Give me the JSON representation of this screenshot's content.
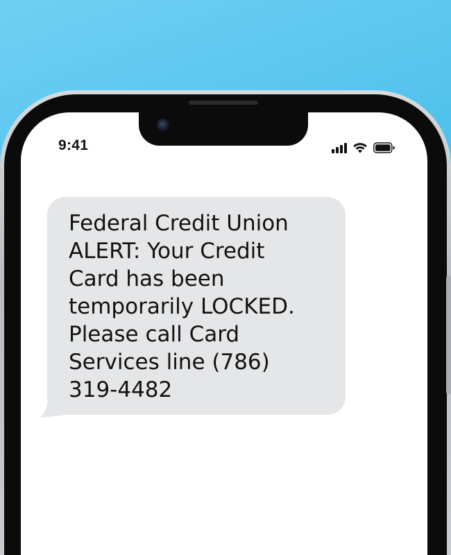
{
  "status_bar": {
    "time": "9:41",
    "icons": [
      "cellular-signal-icon",
      "wifi-icon",
      "battery-icon"
    ]
  },
  "conversation": {
    "messages": [
      {
        "direction": "incoming",
        "text": "Federal Credit Union\nALERT: Your Credit\nCard has been\ntemporarily LOCKED.\nPlease call Card\nServices line (786)\n319-4482"
      }
    ]
  },
  "colors": {
    "background": "#4cc0ec",
    "bubble": "#e5e6e8",
    "screen": "#ffffff",
    "text": "#111111"
  }
}
